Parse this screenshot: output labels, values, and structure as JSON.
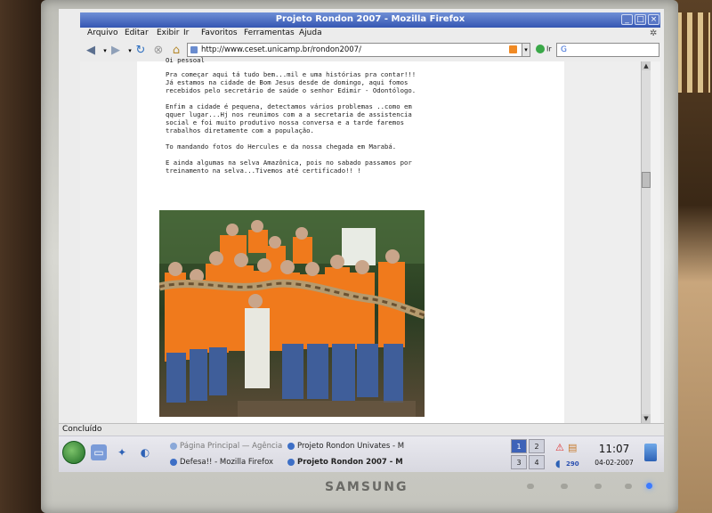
{
  "window": {
    "title": "Projeto Rondon 2007 - Mozilla Firefox",
    "buttons": [
      "_",
      "□",
      "×"
    ]
  },
  "menubar": {
    "items": [
      "Arquivo",
      "Editar",
      "Exibir",
      "Ir",
      "Favoritos",
      "Ferramentas",
      "Ajuda"
    ]
  },
  "toolbar": {
    "back_icon": "back-arrow-icon",
    "forward_icon": "forward-arrow-icon",
    "reload_icon": "reload-icon",
    "stop_icon": "stop-icon",
    "home_icon": "home-icon",
    "url": "http://www.ceset.unicamp.br/rondon2007/",
    "go_label": "Ir",
    "search_placeholder": "G"
  },
  "page": {
    "paragraphs": [
      "Oi pessoal",
      "Pra começar aqui tá tudo bem...mil e uma histórias pra contar!!!\nJá estamos na cidade de Bom Jesus desde de domingo, aqui fomos recebidos pelo secretário de saúde o senhor Edimir - Odontólogo.",
      "Enfim a cidade é pequena, detectamos vários problemas ..como em qquer lugar...Hj nos reunimos com a a secretaria de assistencia social e foi muito produtivo nossa conversa e a tarde faremos trabalhos diretamente com a população.",
      "To mandando fotos do Hercules e da nossa chegada em Marabá.",
      "E ainda algumas na selva Amazônica, pois no sabado passamos por treinamento na selva...Tivemos até certificado!! !"
    ],
    "photo_alt_icon": "group-photo"
  },
  "statusbar": {
    "text": "Concluído"
  },
  "taskbar": {
    "tasks": [
      {
        "label": "Página Principal — Agência",
        "state": "dim"
      },
      {
        "label": "Projeto Rondon Univates - M",
        "state": "normal"
      },
      {
        "label": "Defesa!! - Mozilla Firefox",
        "state": "normal"
      },
      {
        "label": "Projeto Rondon 2007 - M",
        "state": "active"
      }
    ],
    "pager": [
      "1",
      "2",
      "3",
      "4"
    ],
    "tray_count": "290",
    "clock": "11:07",
    "date": "04-02-2007"
  },
  "monitor": {
    "brand": "SAMSUNG"
  },
  "colors": {
    "titlebar": "#3556b2",
    "link": "#3367d6",
    "shirt_orange": "#f07a1c"
  }
}
